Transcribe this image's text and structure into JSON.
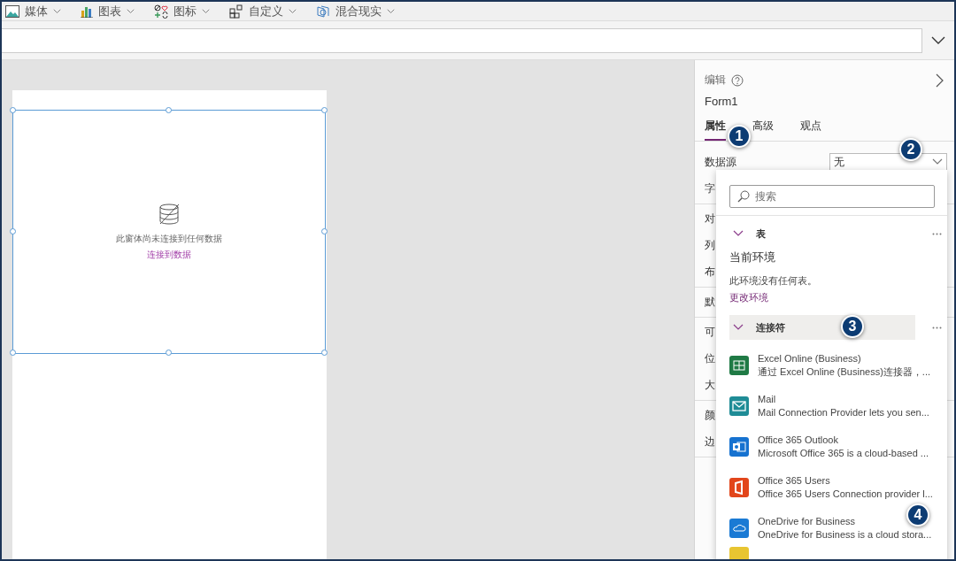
{
  "toolbar": {
    "items": [
      {
        "label": "媒体"
      },
      {
        "label": "图表"
      },
      {
        "label": "图标"
      },
      {
        "label": "自定义"
      },
      {
        "label": "混合现实"
      }
    ]
  },
  "canvas": {
    "message": "此窗体尚未连接到任何数据",
    "link": "连接到数据"
  },
  "panel": {
    "heading": "编辑",
    "title": "Form1",
    "tabs": [
      {
        "label": "属性",
        "selected": true
      },
      {
        "label": "高级",
        "selected": false
      },
      {
        "label": "观点",
        "selected": false
      }
    ],
    "data_source": {
      "label": "数据源",
      "value": "无"
    },
    "property_groups": [
      [
        "字"
      ],
      [
        "对",
        "列",
        "布"
      ],
      [
        "默"
      ],
      [
        "可",
        "位",
        "大"
      ],
      [
        "颜",
        "边"
      ]
    ]
  },
  "dropdown": {
    "search": {
      "placeholder": "搜索"
    },
    "tables": {
      "label": "表",
      "expanded": true,
      "environment": "当前环境",
      "empty_text": "此环境没有任何表。",
      "link": "更改环境"
    },
    "connectors": {
      "label": "连接符",
      "expanded": true,
      "items": [
        {
          "name": "Excel Online (Business)",
          "description": "通过 Excel Online (Business)连接器，..."
        },
        {
          "name": "Mail",
          "description": "Mail Connection Provider lets you sen..."
        },
        {
          "name": "Office 365 Outlook",
          "description": "Microsoft Office 365 is a cloud-based ..."
        },
        {
          "name": "Office 365 Users",
          "description": "Office 365 Users Connection provider l..."
        },
        {
          "name": "OneDrive for Business",
          "description": "OneDrive for Business is a cloud stora..."
        }
      ]
    }
  },
  "callouts": [
    "1",
    "2",
    "3",
    "4"
  ]
}
